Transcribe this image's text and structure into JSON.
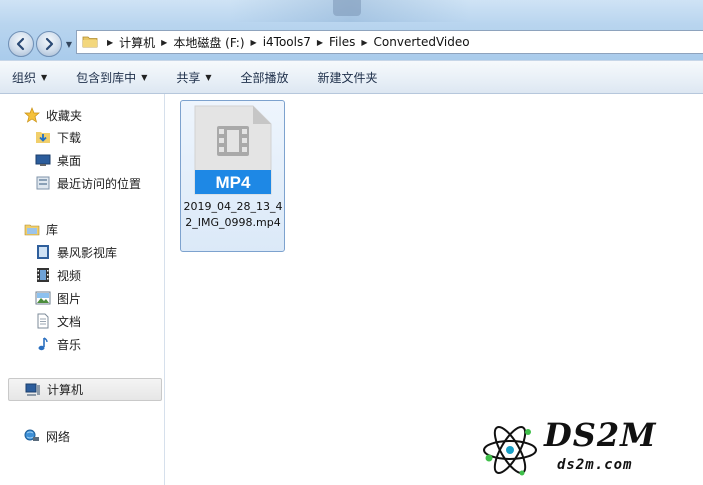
{
  "address_bar": {
    "breadcrumbs": [
      "计算机",
      "本地磁盘 (F:)",
      "i4Tools7",
      "Files",
      "ConvertedVideo"
    ]
  },
  "toolbar": {
    "organize": "组织",
    "include_in_library": "包含到库中",
    "share": "共享",
    "play_all": "全部播放",
    "new_folder": "新建文件夹"
  },
  "nav": {
    "favorites": "收藏夹",
    "downloads": "下载",
    "desktop": "桌面",
    "recent_places": "最近访问的位置",
    "libraries": "库",
    "baofeng_library": "暴风影视库",
    "videos": "视频",
    "pictures": "图片",
    "documents": "文档",
    "music": "音乐",
    "computer": "计算机",
    "network": "网络"
  },
  "content": {
    "file": {
      "badge": "MP4",
      "name": "2019_04_28_13_42_IMG_0998.mp4"
    }
  },
  "watermark": {
    "title": "DS2M",
    "subtitle": "ds2m.com"
  },
  "colors": {
    "mp4_badge": "#1e88e5",
    "file_icon_body": "#e6e6e6",
    "selection": "#dbe9f8"
  }
}
